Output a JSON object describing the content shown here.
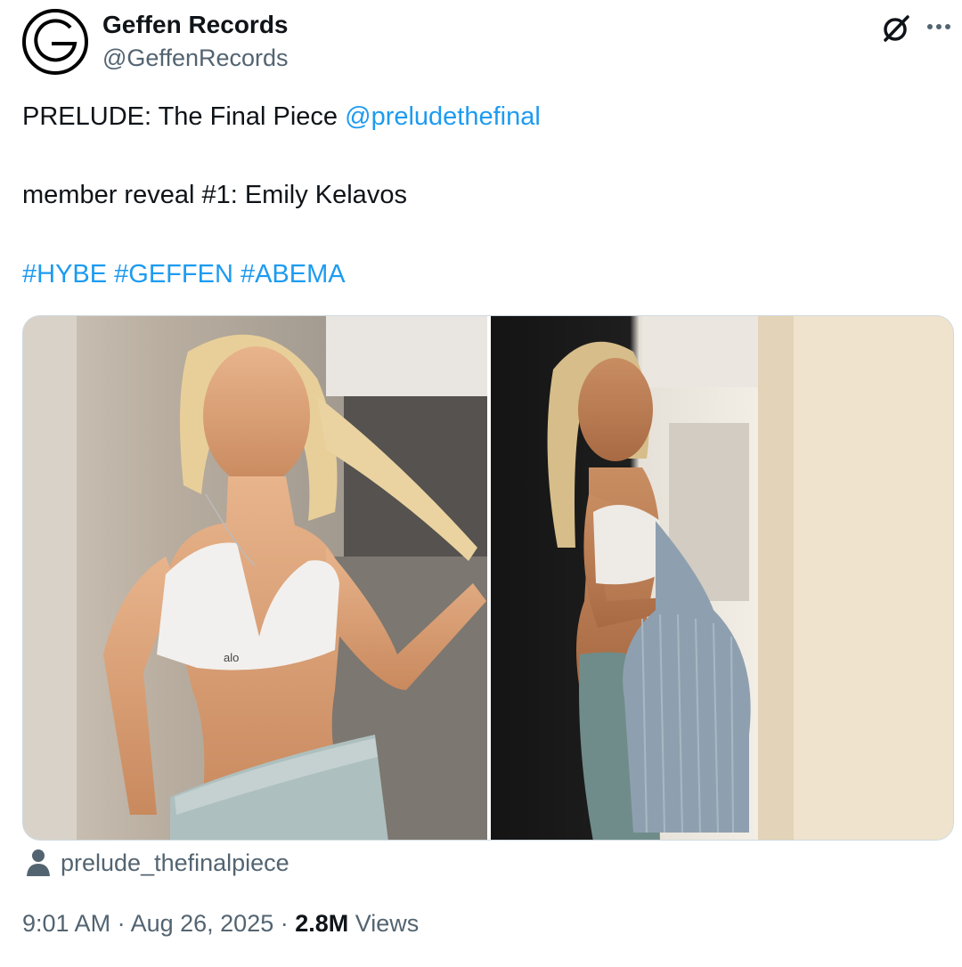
{
  "author": {
    "name": "Geffen Records",
    "handle": "@GeffenRecords"
  },
  "post": {
    "line1_text": "PRELUDE: The Final Piece",
    "line1_mention": "@preludethefinal",
    "line2": "member reveal #1: Emily Kelavos",
    "hashtags": "#HYBE #GEFFEN #ABEMA"
  },
  "media": {
    "images": [
      {
        "icon": "photo-1",
        "bra_logo": "alo"
      },
      {
        "icon": "photo-2"
      }
    ]
  },
  "tagged_user": "prelude_thefinalpiece",
  "meta": {
    "time": "9:01 AM",
    "sep1": " · ",
    "date": "Aug 26, 2025",
    "sep2": " · ",
    "views_count": "2.8M",
    "views_label": " Views"
  },
  "colors": {
    "link": "#1d9bf0",
    "secondary": "#536471",
    "primary": "#0f1419",
    "border": "#cfd9de"
  }
}
